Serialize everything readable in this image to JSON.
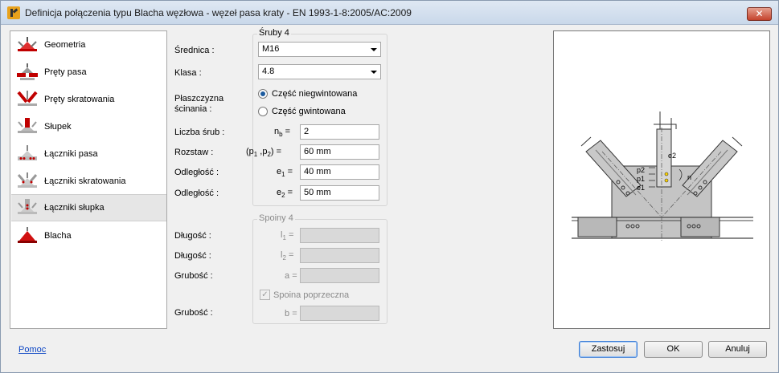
{
  "window": {
    "title": "Definicja połączenia typu Blacha węzłowa - węzeł pasa kraty - EN 1993-1-8:2005/AC:2009",
    "close_label": "✕"
  },
  "nav": {
    "items": [
      {
        "label": "Geometria",
        "icon": "joint-geometry-icon"
      },
      {
        "label": "Pręty pasa",
        "icon": "chord-members-icon"
      },
      {
        "label": "Pręty skratowania",
        "icon": "bracing-members-icon"
      },
      {
        "label": "Słupek",
        "icon": "post-icon"
      },
      {
        "label": "Łączniki pasa",
        "icon": "chord-connectors-icon"
      },
      {
        "label": "Łączniki skratowania",
        "icon": "bracing-connectors-icon"
      },
      {
        "label": "Łączniki słupka",
        "icon": "post-connectors-icon"
      },
      {
        "label": "Blacha",
        "icon": "plate-icon"
      }
    ],
    "selected": "Łączniki słupka"
  },
  "bolts": {
    "group_title": "Śruby 4",
    "diameter_label": "Średnica :",
    "diameter_value": "M16",
    "class_label": "Klasa :",
    "class_value": "4.8",
    "shear_plane_label_1": "Płaszczyzna",
    "shear_plane_label_2": "ścinania :",
    "shear_options": [
      "Część niegwintowana",
      "Część gwintowana"
    ],
    "shear_selected": "Część niegwintowana",
    "count_label": "Liczba śrub :",
    "count_symbol": "n",
    "count_symbol_sub": "b",
    "count_value": "2",
    "spacing_label": "Rozstaw :",
    "spacing_symbol": "(p",
    "spacing_sub1": "1",
    "spacing_mid": " ,p",
    "spacing_sub2": "2",
    "spacing_end": ")",
    "spacing_value": "60 mm",
    "dist1_label": "Odległość :",
    "dist1_symbol": "e",
    "dist1_sub": "1",
    "dist1_value": "40 mm",
    "dist2_label": "Odległość :",
    "dist2_symbol": "e",
    "dist2_sub": "2",
    "dist2_value": "50 mm",
    "eq": "="
  },
  "welds": {
    "group_title": "Spoiny 4",
    "len1_label": "Długość :",
    "len1_symbol": "l",
    "len1_sub": "1",
    "len2_label": "Długość :",
    "len2_symbol": "l",
    "len2_sub": "2",
    "thick_label": "Grubość :",
    "thick_symbol": "a",
    "transverse_label": "Spoina poprzeczna",
    "transverse_checked": true,
    "thick2_label": "Grubość :",
    "thick2_symbol": "b",
    "eq": "="
  },
  "drawing": {
    "labels": [
      "e2",
      "p2",
      "p1",
      "e1",
      "n"
    ]
  },
  "footer": {
    "help_label": "Pomoc",
    "apply_label": "Zastosuj",
    "ok_label": "OK",
    "cancel_label": "Anuluj"
  }
}
